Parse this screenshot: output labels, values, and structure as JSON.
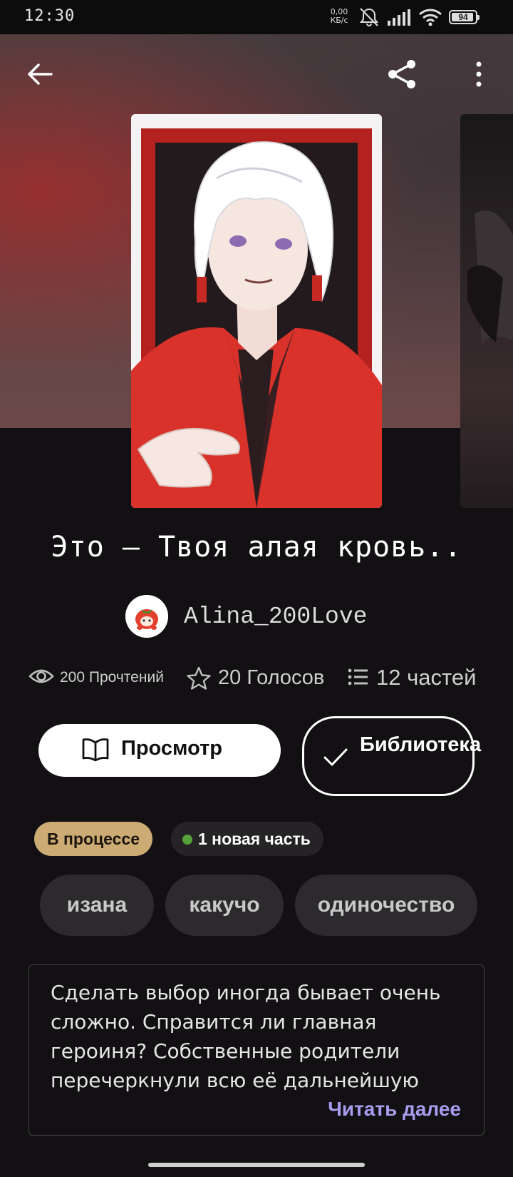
{
  "status_bar": {
    "time": "12:30",
    "net_speed_value": "0,00",
    "net_speed_unit": "КБ/с",
    "battery_level": "94"
  },
  "book": {
    "title": "Это – Твоя алая кровь..",
    "author": "Alina_200Love",
    "stats": {
      "reads": "200 Прочтений",
      "votes": "20 Голосов",
      "parts": "12 частей"
    },
    "actions": {
      "view_label": "Просмотр",
      "library_label": "Библиотека"
    },
    "status_badge": "В процессе",
    "new_parts_badge": "1 новая часть",
    "tags": [
      "изана",
      "какучо",
      "одиночество"
    ],
    "description": "Сделать выбор иногда бывает очень сложно. Справится ли главная героиня? Собственные родители перечеркнули всю её дальнейшую",
    "read_more_label": "Читать далее"
  },
  "colors": {
    "status_badge_bg": "#cdab74",
    "new_dot": "#58a23a",
    "link_accent": "#a99cf0"
  },
  "icons": {
    "back": "arrow-left-icon",
    "share": "share-icon",
    "more": "more-vertical-icon",
    "reads": "eye-icon",
    "votes": "star-icon",
    "parts": "list-icon",
    "view": "open-book-icon",
    "library": "check-icon"
  }
}
